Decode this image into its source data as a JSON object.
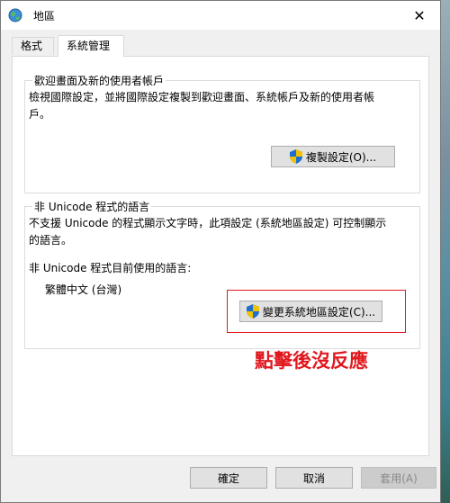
{
  "window": {
    "title": "地區",
    "close_glyph": "✕"
  },
  "tabs": [
    {
      "label": "格式",
      "active": false
    },
    {
      "label": "系統管理",
      "active": true
    }
  ],
  "welcome_group": {
    "title": "歡迎畫面及新的使用者帳戶",
    "description": "檢視國際設定，並將國際設定複製到歡迎畫面、系統帳戶及新的使用者帳戶。",
    "copy_button": "複製設定(O)..."
  },
  "unicode_group": {
    "title": "非 Unicode 程式的語言",
    "description": "不支援 Unicode 的程式顯示文字時，此項設定 (系統地區設定) 可控制顯示的語言。",
    "current_label": "非 Unicode 程式目前使用的語言:",
    "current_value": "繁體中文 (台灣)",
    "change_button": "變更系統地區設定(C)..."
  },
  "annotation": {
    "text": "點擊後沒反應",
    "color": "#e0181e"
  },
  "footer": {
    "ok": "確定",
    "cancel": "取消",
    "apply": "套用(A)"
  },
  "icons": {
    "app": "globe-icon",
    "shield": "uac-shield-icon",
    "close": "close-icon"
  }
}
